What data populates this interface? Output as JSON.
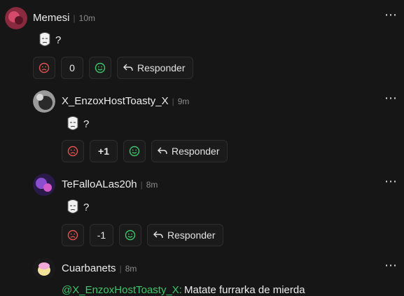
{
  "colors": {
    "background": "#161616",
    "upvote": "#3fc56b",
    "downvote": "#e05252",
    "mention": "#3fc56b"
  },
  "comments": [
    {
      "username": "Memesi",
      "time": "10m",
      "text": "?",
      "score": "0",
      "reply_label": "Responder",
      "avatar_icon": "pink-avatar"
    },
    {
      "username": "X_EnzoxHostToasty_X",
      "time": "9m",
      "text": "?",
      "score": "+1",
      "reply_label": "Responder",
      "avatar_icon": "gray-avatar"
    },
    {
      "username": "TeFalloALas20h",
      "time": "8m",
      "text": "?",
      "score": "-1",
      "reply_label": "Responder",
      "avatar_icon": "purple-avatar"
    },
    {
      "username": "Cuarbanets",
      "time": "8m",
      "mention": "@X_EnzoxHostToasty_X:",
      "text": "Matate furrarka de mierda",
      "avatar_icon": "egg-avatar"
    }
  ],
  "separator": "|",
  "menu_icon": "⋯"
}
